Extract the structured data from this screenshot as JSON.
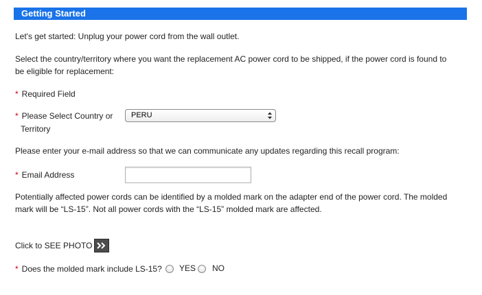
{
  "header": {
    "title": "Getting Started"
  },
  "intro": {
    "line1": "Let's get started: Unplug your power cord from the wall outlet.",
    "line2a": "Select the country/territory where you want the replacement AC power cord to be shipped, if the power cord is found to",
    "line2b": "be eligible for replacement:"
  },
  "required_note": {
    "asterisk": "*",
    "label": "Required Field"
  },
  "country": {
    "asterisk": "*",
    "label_line1": "Please Select Country or",
    "label_line2": "Territory",
    "selected": "PERU"
  },
  "email_prompt": "Please enter your e-mail address so that we can communicate any updates regarding this recall program:",
  "email": {
    "asterisk": "*",
    "label": "Email Address",
    "value": ""
  },
  "info": {
    "line1": "Potentially affected power cords can be identified by a molded mark on the adapter end of the power cord. The molded",
    "line2": "mark will be “LS-15”. Not all power cords with the “LS-15” molded mark are affected."
  },
  "photo": {
    "label": "Click to SEE PHOTO",
    "icon": "double-chevron-right-icon"
  },
  "question": {
    "asterisk": "*",
    "label": "Does the molded mark include LS-15?",
    "options": [
      "YES",
      "NO"
    ]
  },
  "colors": {
    "banner": "#1a73e8",
    "required": "#cc0000"
  }
}
